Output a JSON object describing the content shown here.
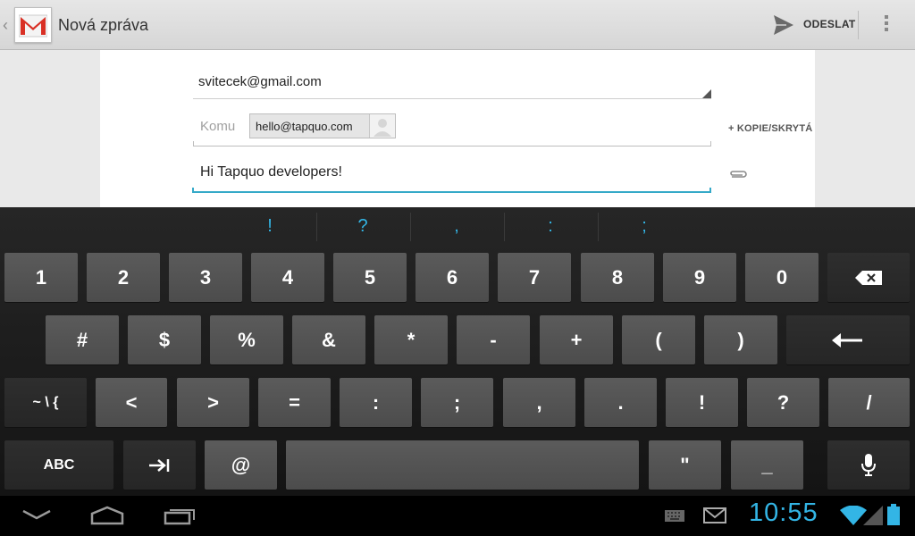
{
  "action_bar": {
    "title": "Nová zpráva",
    "send_label": "ODESLAT"
  },
  "compose": {
    "from_value": "svitecek@gmail.com",
    "to_label": "Komu",
    "to_chip": "hello@tapquo.com",
    "cc_bcc_label": "+ KOPIE/SKRYTÁ",
    "subject_value": "Hi Tapquo developers!"
  },
  "keyboard": {
    "suggestions": [
      "!",
      "?",
      ",",
      ":",
      ";"
    ],
    "row1": [
      "1",
      "2",
      "3",
      "4",
      "5",
      "6",
      "7",
      "8",
      "9",
      "0"
    ],
    "row2": [
      "#",
      "$",
      "%",
      "&",
      "*",
      "-",
      "+",
      "(",
      ")"
    ],
    "row3_shift": "~ \\ {",
    "row3": [
      "<",
      ">",
      "=",
      ":",
      ";",
      ",",
      ".",
      "!",
      "?",
      "/"
    ],
    "abc_label": "ABC",
    "at_label": "@",
    "quote_label": "\"",
    "underscore_label": "_"
  },
  "status_bar": {
    "time": "10:55"
  },
  "colors": {
    "accent": "#33b5e5",
    "key": "#555555",
    "action_bar": "#dedede"
  }
}
